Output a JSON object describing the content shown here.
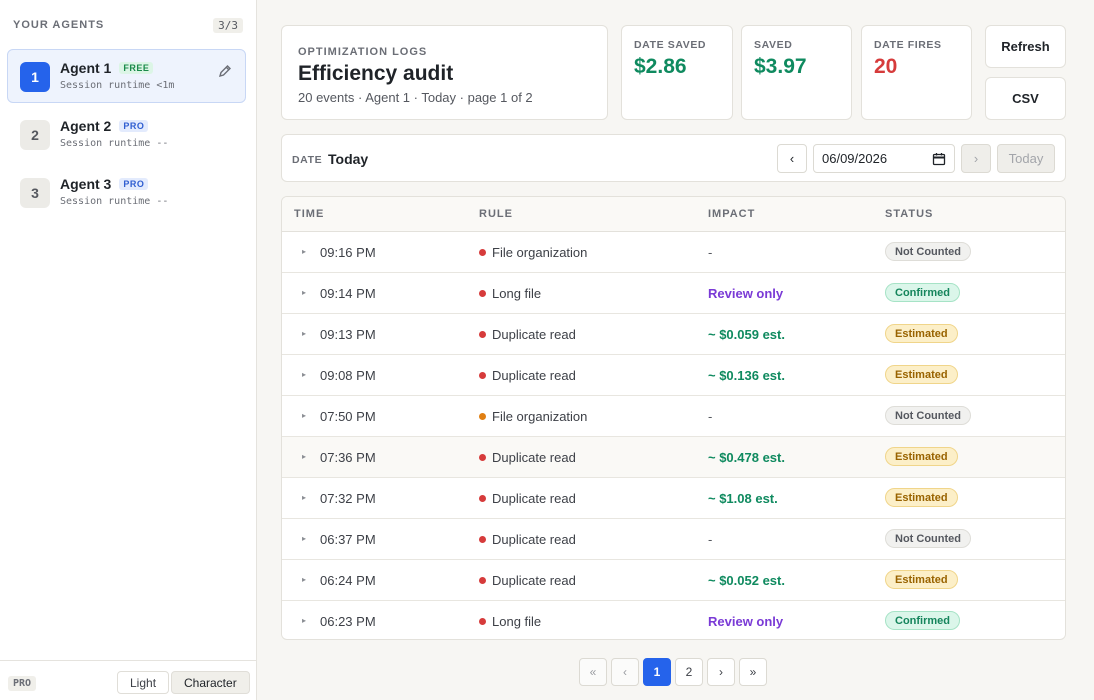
{
  "sidebar": {
    "title": "YOUR AGENTS",
    "count": "3/3",
    "agents": [
      {
        "num": "1",
        "name": "Agent 1",
        "tier": "FREE",
        "runtime": "Session runtime <1m"
      },
      {
        "num": "2",
        "name": "Agent 2",
        "tier": "PRO",
        "runtime": "Session runtime --"
      },
      {
        "num": "3",
        "name": "Agent 3",
        "tier": "PRO",
        "runtime": "Session runtime --"
      }
    ],
    "footer": {
      "pro": "PRO",
      "light": "Light",
      "character": "Character"
    }
  },
  "header": {
    "label": "OPTIMIZATION LOGS",
    "title": "Efficiency audit",
    "subtitle": "20 events · Agent 1 · Today · page 1 of 2"
  },
  "stats": [
    {
      "label": "DATE SAVED",
      "value": "$2.86"
    },
    {
      "label": "SAVED",
      "value": "$3.97"
    },
    {
      "label": "DATE FIRES",
      "value": "20"
    }
  ],
  "actions": {
    "refresh": "Refresh",
    "csv": "CSV"
  },
  "date_bar": {
    "label": "DATE",
    "value": "Today",
    "prev": "‹",
    "next": "›",
    "input": "06/09/2026",
    "today": "Today"
  },
  "table": {
    "headers": {
      "time": "TIME",
      "rule": "RULE",
      "impact": "IMPACT",
      "status": "STATUS"
    },
    "rows": [
      {
        "time": "09:16 PM",
        "rule": "File organization",
        "impact": "-",
        "status": "Not Counted"
      },
      {
        "time": "09:14 PM",
        "rule": "Long file",
        "impact": "Review only",
        "status": "Confirmed"
      },
      {
        "time": "09:13 PM",
        "rule": "Duplicate read",
        "impact": "~ $0.059 est.",
        "status": "Estimated"
      },
      {
        "time": "09:08 PM",
        "rule": "Duplicate read",
        "impact": "~ $0.136 est.",
        "status": "Estimated"
      },
      {
        "time": "07:50 PM",
        "rule": "File organization",
        "impact": "-",
        "status": "Not Counted"
      },
      {
        "time": "07:36 PM",
        "rule": "Duplicate read",
        "impact": "~ $0.478 est.",
        "status": "Estimated"
      },
      {
        "time": "07:32 PM",
        "rule": "Duplicate read",
        "impact": "~ $1.08 est.",
        "status": "Estimated"
      },
      {
        "time": "06:37 PM",
        "rule": "Duplicate read",
        "impact": "-",
        "status": "Not Counted"
      },
      {
        "time": "06:24 PM",
        "rule": "Duplicate read",
        "impact": "~ $0.052 est.",
        "status": "Estimated"
      },
      {
        "time": "06:23 PM",
        "rule": "Long file",
        "impact": "Review only",
        "status": "Confirmed"
      }
    ]
  },
  "pagination": {
    "first": "«",
    "prev": "‹",
    "pages": [
      "1",
      "2"
    ],
    "next": "›",
    "last": "»"
  }
}
